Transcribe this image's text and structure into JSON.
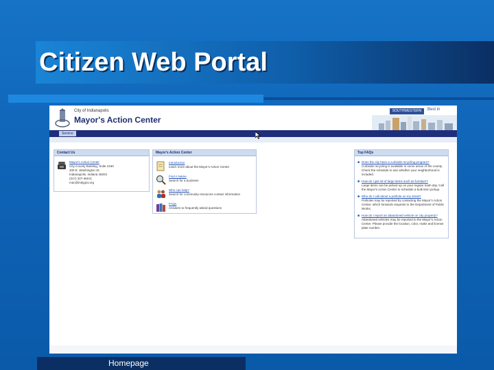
{
  "slide": {
    "title": "Citizen Web Portal",
    "caption": "Homepage"
  },
  "site": {
    "city_name": "City of Indianapolis",
    "site_title": "Mayor's Action Center",
    "nav_tab": "Service",
    "partner_logo_text": "SOUTHWESTERN BELL",
    "partner_link": "Best in"
  },
  "contact_panel": {
    "heading": "Contact Us",
    "link": "Mayor's Action Center",
    "lines": [
      "City-County Building, Suite 2160",
      "200 E. Washington St.",
      "Indianapolis, Indiana 46204",
      "(317) 327-4MAC",
      "mac@indygov.org"
    ]
  },
  "mac_panel": {
    "heading": "Mayor's Action Center",
    "items": [
      {
        "link": "Introduction",
        "desc": "Learn more about the Mayor's Action Center"
      },
      {
        "link": "Find A Name",
        "desc": "Search for a business"
      },
      {
        "link": "Who can help?",
        "desc": "Search for community resources contact information"
      },
      {
        "link": "FAQs",
        "desc": "Answers to frequently asked questions"
      }
    ]
  },
  "faq_panel": {
    "heading": "Top FAQs",
    "items": [
      {
        "q": "Does the city have a curbside recycling program?",
        "a": "Curbside recycling is available in some areas of the county. Check the schedule to see whether your neighborhood is included."
      },
      {
        "q": "How do I get rid of large items such as furniture?",
        "a": "Large items can be picked up on your regular trash day. Call the Mayor's Action Center to schedule a bulk item pickup."
      },
      {
        "q": "Who do I call about a pothole on my street?",
        "a": "Potholes may be reported by contacting the Mayor's Action Center, which forwards requests to the Department of Public Works."
      },
      {
        "q": "How do I report an abandoned vehicle on city property?",
        "a": "Abandoned vehicles may be reported to the Mayor's Action Center. Please provide the location, color, make and license plate number."
      }
    ]
  },
  "colors": {
    "slide_background": "#1673c6",
    "title_bar_dark": "#0b2f63",
    "site_nav": "#1f2e7a",
    "link_blue": "#1f4fb6"
  }
}
